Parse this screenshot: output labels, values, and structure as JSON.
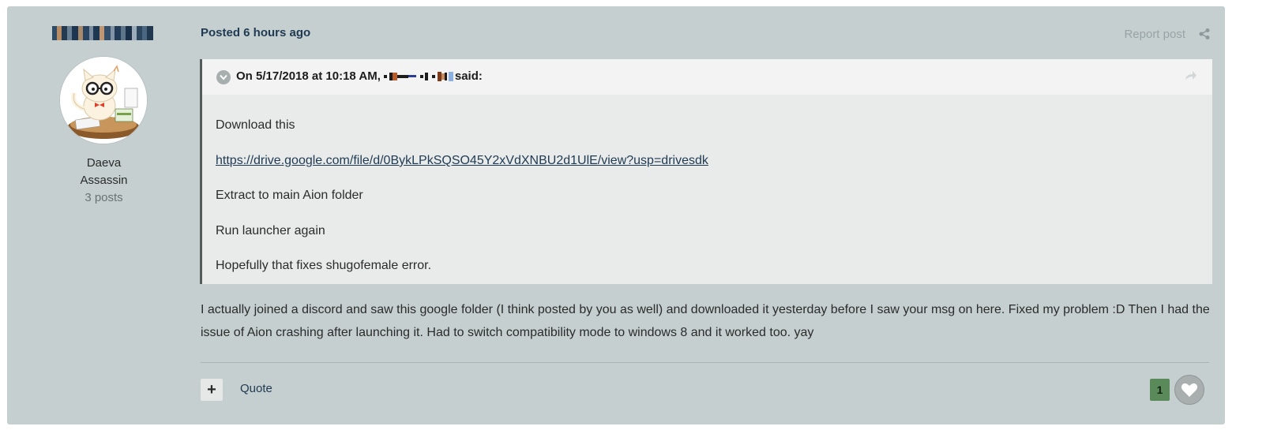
{
  "author": {
    "username_label": "Username (pixelated)",
    "title": "Daeva",
    "class": "Assassin",
    "posts": "3 posts",
    "avatar_icon": "avatar-cat-with-glasses"
  },
  "post": {
    "posted_label": "Posted 6 hours ago",
    "report_label": "Report post",
    "share_icon": "share-icon",
    "quote": {
      "citation_prefix": "On 5/17/2018 at 10:18 AM,",
      "citation_suffix": "said:",
      "lines": [
        "Download this",
        "https://drive.google.com/file/d/0BykLPkSQSO45Y2xVdXNBU2d1UlE/view?usp=drivesdk",
        "Extract to main Aion folder",
        "Run launcher again",
        "Hopefully that fixes shugofemale error."
      ]
    },
    "body": "I actually joined a discord and saw this google folder (I think posted by you as well) and downloaded it yesterday before I saw your msg on here. Fixed my problem :D Then I had the issue of Aion crashing after launching it. Had to switch compatibility mode to windows 8 and it worked too. yay",
    "footer": {
      "plus_label": "+",
      "quote_label": "Quote",
      "reputation": "1"
    }
  },
  "colors": {
    "post_background": "#c5cfcf",
    "link": "#1f3a52",
    "reputation": "#5a8a5a"
  }
}
